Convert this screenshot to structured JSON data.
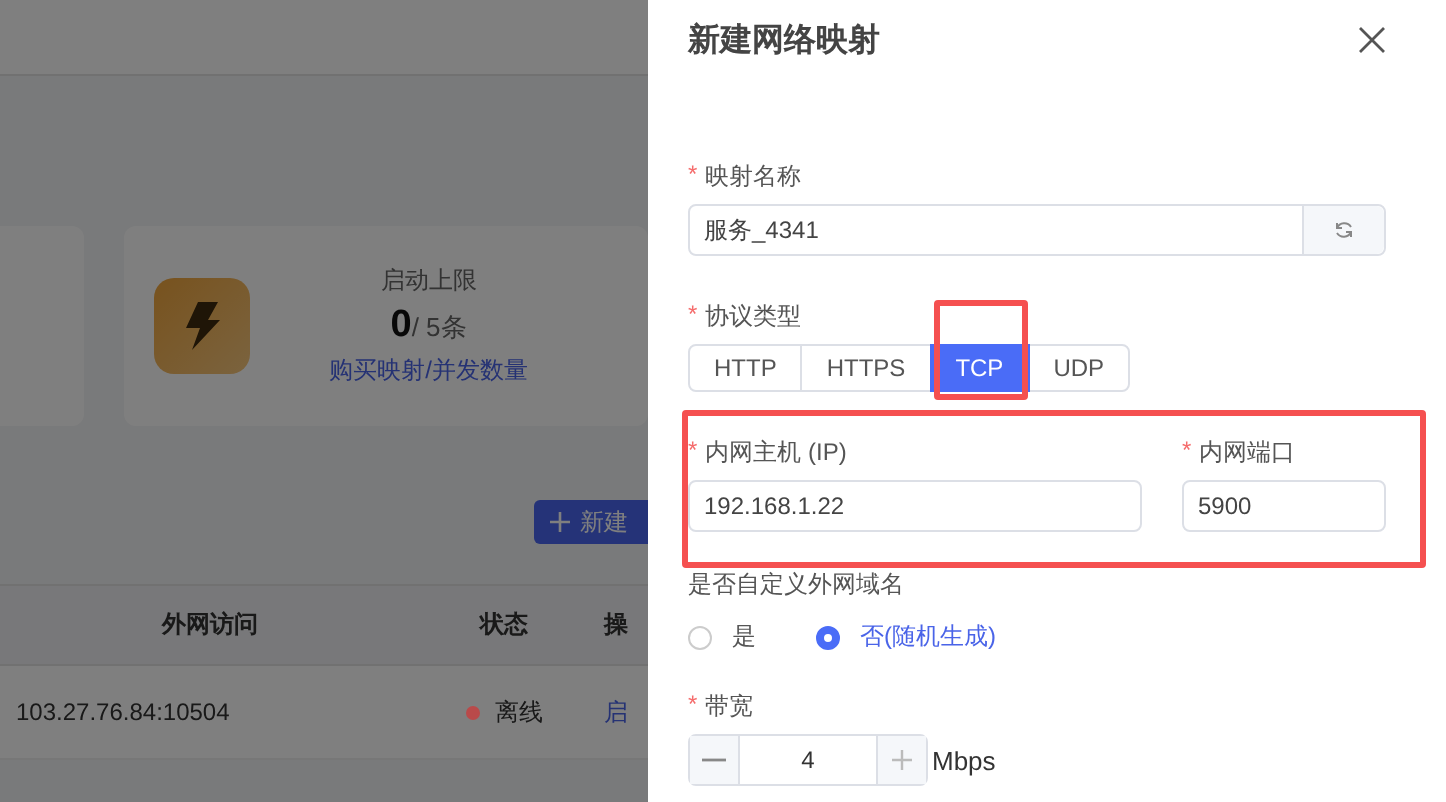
{
  "background_page": {
    "stat_card": {
      "label": "启动上限",
      "count": "0",
      "limit": "/ 5条",
      "link": "购买映射/并发数量"
    },
    "new_button": "新建",
    "table": {
      "columns": [
        "外网访问",
        "状态",
        "操"
      ],
      "rows": [
        {
          "address": "103.27.76.84:10504",
          "status": "离线",
          "color": "#b94a4a",
          "action": "启"
        }
      ]
    }
  },
  "drawer": {
    "title": "新建网络映射",
    "name_field": {
      "mark": "*",
      "label": "映射名称",
      "value": "服务_4341"
    },
    "protocol": {
      "mark": "*",
      "label": "协议类型",
      "options": [
        {
          "label": "HTTP",
          "selected": false,
          "highlighted": false
        },
        {
          "label": "HTTPS",
          "selected": false,
          "highlighted": false
        },
        {
          "label": "TCP",
          "selected": true,
          "highlighted": true
        },
        {
          "label": "UDP",
          "selected": false,
          "highlighted": false
        }
      ]
    },
    "host_row": {
      "highlighted": true,
      "host": {
        "mark": "*",
        "label": "内网主机 (IP)",
        "value": "192.168.1.22"
      },
      "port": {
        "mark": "*",
        "label": "内网端口",
        "value": "5900"
      }
    },
    "custom_domain": {
      "label": "是否自定义外网域名",
      "options": [
        {
          "label": "是",
          "selected": false
        },
        {
          "label": "否(随机生成)",
          "selected": true
        }
      ]
    },
    "bandwidth": {
      "mark": "*",
      "label": "带宽",
      "value": "4",
      "unit": "Mbps"
    }
  }
}
